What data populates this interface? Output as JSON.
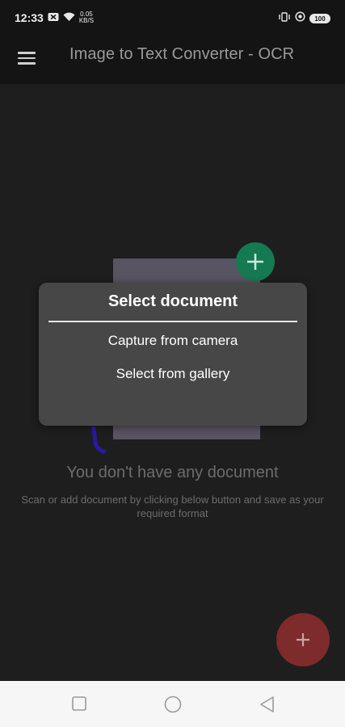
{
  "status_bar": {
    "time": "12:33",
    "net_speed_value": "0.05",
    "net_speed_unit": "KB/S",
    "battery": "100",
    "icons": [
      "notification-x-icon",
      "wifi-icon",
      "vibrate-icon",
      "data-saver-icon",
      "battery-icon"
    ]
  },
  "app_bar": {
    "title": "Image to Text Converter - OCR",
    "menu_icon": "hamburger-menu-icon"
  },
  "empty_state": {
    "title": "You don't have any document",
    "subtitle": "Scan or add document by clicking below button and save as your required format"
  },
  "dialog": {
    "title": "Select document",
    "options": [
      "Capture from camera",
      "Select from gallery"
    ]
  },
  "fab": {
    "icon": "plus-icon"
  },
  "nav_bar": {
    "icons": [
      "recents-square-icon",
      "home-circle-icon",
      "back-triangle-icon"
    ]
  },
  "colors": {
    "background": "#1e1e1e",
    "appbar": "#141414",
    "dialog": "#474747",
    "fab": "#7d2b2b",
    "illustration_plus": "#157a52"
  }
}
